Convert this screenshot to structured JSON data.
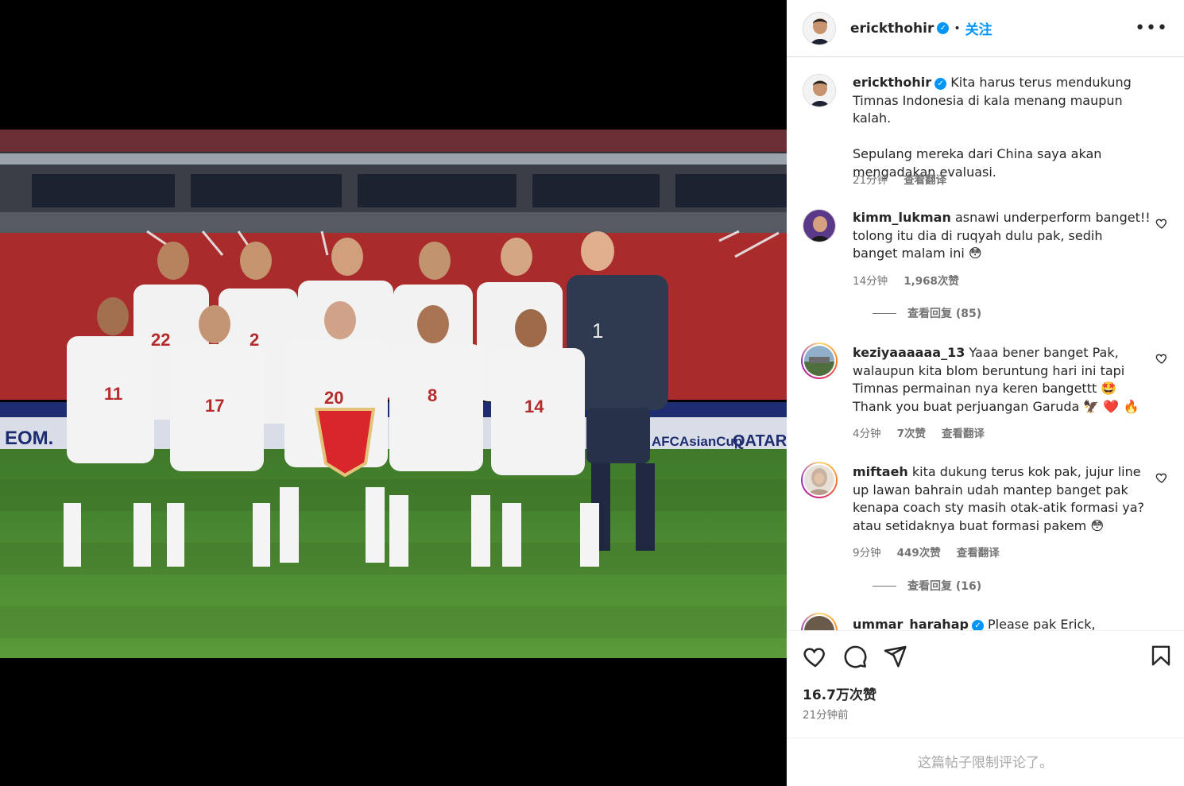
{
  "header": {
    "username": "erickthohir",
    "follow_label": "关注",
    "more_label": "•••"
  },
  "caption": {
    "username": "erickthohir",
    "line1": "Kita harus terus mendukung Timnas Indonesia di kala menang maupun kalah.",
    "line2": "Sepulang mereka dari China saya akan mengadakan evaluasi.",
    "time": "21分钟",
    "translate": "查看翻译"
  },
  "comments": [
    {
      "username": "kimm_lukman",
      "text": "asnawi underperform banget!! tolong itu dia di ruqyah dulu pak, sedih banget malam ini 😳",
      "time": "14分钟",
      "likes": "1,968次赞",
      "translate": "",
      "replies": "查看回复 (85)"
    },
    {
      "username": "keziyaaaaaa_13",
      "text": "Yaaa bener banget Pak, walaupun kita blom beruntung hari ini tapi Timnas permainan nya keren bangettt 🤩 Thank you buat perjuangan Garuda 🦅 ❤️ 🔥",
      "time": "4分钟",
      "likes": "7次赞",
      "translate": "查看翻译",
      "replies": ""
    },
    {
      "username": "miftaeh",
      "text": "kita dukung terus kok pak, jujur line up lawan bahrain udah mantep banget pak kenapa coach sty masih otak-atik formasi ya? atau setidaknya buat formasi pakem 😳",
      "time": "9分钟",
      "likes": "449次赞",
      "translate": "查看翻译",
      "replies": "查看回复 (16)"
    },
    {
      "username": "ummar_harahap",
      "text": "Please pak Erick, asnawai &"
    }
  ],
  "footer": {
    "likes": "16.7万次赞",
    "ago": "21分钟前",
    "limited": "这篇帖子限制评论了。"
  },
  "icons": {
    "like": "heart-icon",
    "comment": "comment-icon",
    "share": "send-icon",
    "save": "bookmark-icon"
  },
  "colors": {
    "accent": "#0095f6",
    "muted": "#737373",
    "text": "#262626"
  }
}
